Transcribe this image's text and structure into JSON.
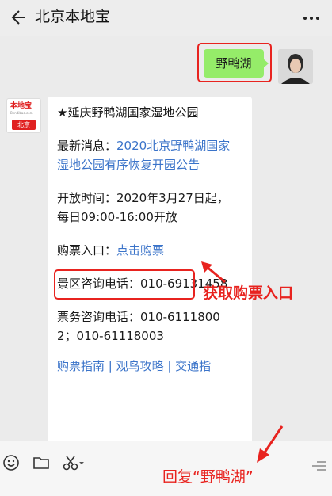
{
  "header": {
    "title": "北京本地宝"
  },
  "user_message": {
    "text": "野鸭湖"
  },
  "bot": {
    "avatar_logo": "本地宝",
    "avatar_sub": "Bendibao.com",
    "avatar_city": "北京",
    "title": "★延庆野鸭湖国家湿地公园",
    "news_label": "最新消息：",
    "news_link": "2020北京野鸭湖国家湿地公园有序恢复开园公告",
    "open_time": "开放时间：2020年3月27日起，每日09:00-16:00开放",
    "ticket_label": "购票入口：",
    "ticket_link": "点击购票",
    "scenic_phone": "景区咨询电话：010-69131458",
    "ticket_phone": "票务咨询电话：010-61118002；010-61118003",
    "footer_links": "购票指南 | 观鸟攻略 | 交通指"
  },
  "annotations": {
    "buy_entry": "获取购票入口",
    "reply_hint": "回复“野鸭湖”"
  },
  "colors": {
    "accent_red": "#e8231f",
    "bubble_green": "#95ec69",
    "link_blue": "#3a73c9"
  }
}
